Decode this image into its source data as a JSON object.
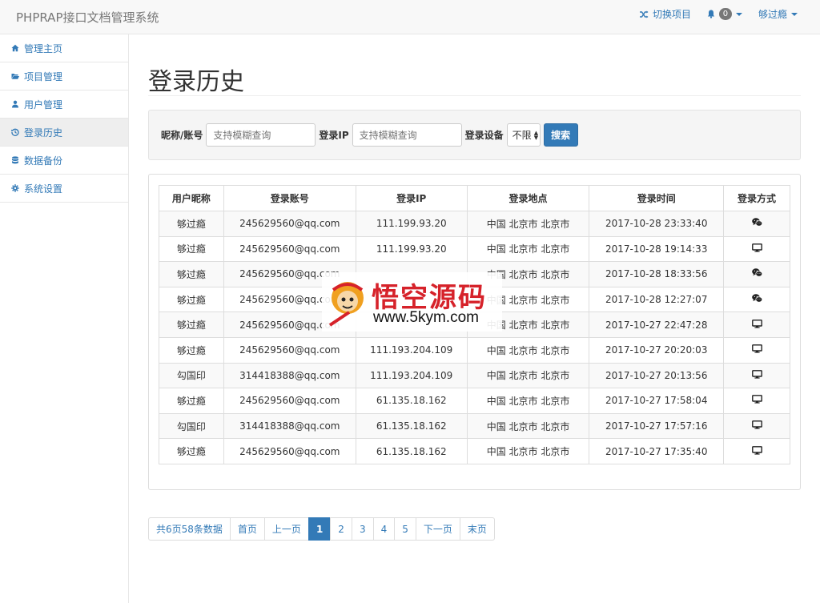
{
  "app": {
    "brand": "PHPRAP接口文档管理系统"
  },
  "navbar": {
    "switch_project": "切换项目",
    "notifications_count": "0",
    "user_name": "够过瘾"
  },
  "sidebar": {
    "items": [
      {
        "label": "管理主页",
        "icon": "home-icon",
        "active": false
      },
      {
        "label": "项目管理",
        "icon": "folder-open-icon",
        "active": false
      },
      {
        "label": "用户管理",
        "icon": "user-icon",
        "active": false
      },
      {
        "label": "登录历史",
        "icon": "history-icon",
        "active": true
      },
      {
        "label": "数据备份",
        "icon": "database-icon",
        "active": false
      },
      {
        "label": "系统设置",
        "icon": "gear-icon",
        "active": false
      }
    ]
  },
  "page": {
    "title": "登录历史"
  },
  "filter": {
    "nickname_label": "昵称/账号",
    "nickname_placeholder": "支持模糊查询",
    "ip_label": "登录IP",
    "ip_placeholder": "支持模糊查询",
    "device_label": "登录设备",
    "device_value": "不限",
    "search_label": "搜索"
  },
  "table": {
    "headers": [
      "用户昵称",
      "登录账号",
      "登录IP",
      "登录地点",
      "登录时间",
      "登录方式"
    ],
    "rows": [
      {
        "nickname": "够过瘾",
        "account": "245629560@qq.com",
        "ip": "111.199.93.20",
        "location": "中国 北京市 北京市",
        "time": "2017-10-28 23:33:40",
        "method": "wechat-icon"
      },
      {
        "nickname": "够过瘾",
        "account": "245629560@qq.com",
        "ip": "111.199.93.20",
        "location": "中国 北京市 北京市",
        "time": "2017-10-28 19:14:33",
        "method": "desktop-icon"
      },
      {
        "nickname": "够过瘾",
        "account": "245629560@qq.com",
        "ip": "",
        "location": "中国 北京市 北京市",
        "time": "2017-10-28 18:33:56",
        "method": "wechat-icon"
      },
      {
        "nickname": "够过瘾",
        "account": "245629560@qq.com",
        "ip": "",
        "location": "中国 北京市 北京市",
        "time": "2017-10-28 12:27:07",
        "method": "wechat-icon"
      },
      {
        "nickname": "够过瘾",
        "account": "245629560@qq.com",
        "ip": "",
        "location": "中国 北京市 北京市",
        "time": "2017-10-27 22:47:28",
        "method": "desktop-icon"
      },
      {
        "nickname": "够过瘾",
        "account": "245629560@qq.com",
        "ip": "111.193.204.109",
        "location": "中国 北京市 北京市",
        "time": "2017-10-27 20:20:03",
        "method": "desktop-icon"
      },
      {
        "nickname": "勾国印",
        "account": "314418388@qq.com",
        "ip": "111.193.204.109",
        "location": "中国 北京市 北京市",
        "time": "2017-10-27 20:13:56",
        "method": "desktop-icon"
      },
      {
        "nickname": "够过瘾",
        "account": "245629560@qq.com",
        "ip": "61.135.18.162",
        "location": "中国 北京市 北京市",
        "time": "2017-10-27 17:58:04",
        "method": "desktop-icon"
      },
      {
        "nickname": "勾国印",
        "account": "314418388@qq.com",
        "ip": "61.135.18.162",
        "location": "中国 北京市 北京市",
        "time": "2017-10-27 17:57:16",
        "method": "desktop-icon"
      },
      {
        "nickname": "够过瘾",
        "account": "245629560@qq.com",
        "ip": "61.135.18.162",
        "location": "中国 北京市 北京市",
        "time": "2017-10-27 17:35:40",
        "method": "desktop-icon"
      }
    ]
  },
  "pagination": {
    "summary": "共6页58条数据",
    "first": "首页",
    "prev": "上一页",
    "pages": [
      "1",
      "2",
      "3",
      "4",
      "5"
    ],
    "current": "1",
    "next": "下一页",
    "last": "末页"
  },
  "watermark": {
    "text": "悟空源码",
    "url": "www.5kym.com"
  },
  "colors": {
    "accent": "#337ab7",
    "watermark_red": "#d6222a"
  }
}
